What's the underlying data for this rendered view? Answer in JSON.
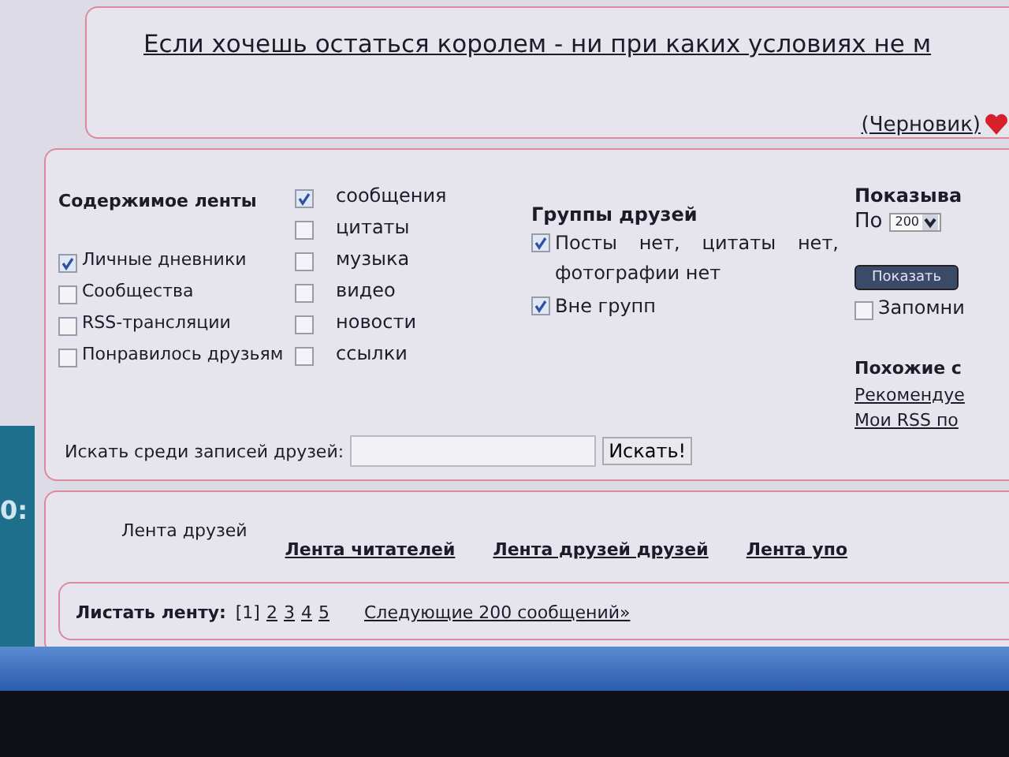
{
  "title_link": "Если хочешь остаться королем - ни при каких условиях не м",
  "draft_link": "(Черновик)",
  "side_clock": "0:",
  "feed_content": {
    "heading": "Содержимое ленты",
    "sources": [
      {
        "label": "Личные дневники",
        "checked": true
      },
      {
        "label": "Сообщества",
        "checked": false
      },
      {
        "label": "RSS-трансляции",
        "checked": false
      },
      {
        "label": "Понравилось друзьям",
        "checked": false
      }
    ],
    "types": [
      {
        "label": "сообщения",
        "checked": true
      },
      {
        "label": "цитаты",
        "checked": false
      },
      {
        "label": "музыка",
        "checked": false
      },
      {
        "label": "видео",
        "checked": false
      },
      {
        "label": "новости",
        "checked": false
      },
      {
        "label": "ссылки",
        "checked": false
      }
    ]
  },
  "search": {
    "label": "Искать среди записей друзей:",
    "button": "Искать!"
  },
  "friend_groups": {
    "heading": "Группы друзей",
    "items": [
      {
        "label": "Посты нет, цитаты нет, фотографии нет",
        "checked": true
      },
      {
        "label": "Вне групп",
        "checked": true
      }
    ]
  },
  "show": {
    "heading": "Показыва",
    "prefix": "По",
    "select_value": "200",
    "button": "Показать",
    "remember": {
      "label": "Запомни",
      "checked": false
    }
  },
  "similar": {
    "heading": "Похожие с",
    "links": [
      "Рекомендуе",
      "Мои RSS по"
    ]
  },
  "tabs": [
    {
      "label": "Лента друзей",
      "selected": true
    },
    {
      "label": "Лента читателей",
      "selected": false
    },
    {
      "label": "Лента друзей друзей",
      "selected": false
    },
    {
      "label": "Лента упо",
      "selected": false
    }
  ],
  "pager": {
    "label": "Листать ленту:",
    "pages": [
      {
        "label": "[1]",
        "selected": true
      },
      {
        "label": "2",
        "selected": false
      },
      {
        "label": "3",
        "selected": false
      },
      {
        "label": "4",
        "selected": false
      },
      {
        "label": "5",
        "selected": false
      }
    ],
    "next": "Следующие 200 сообщений»"
  }
}
